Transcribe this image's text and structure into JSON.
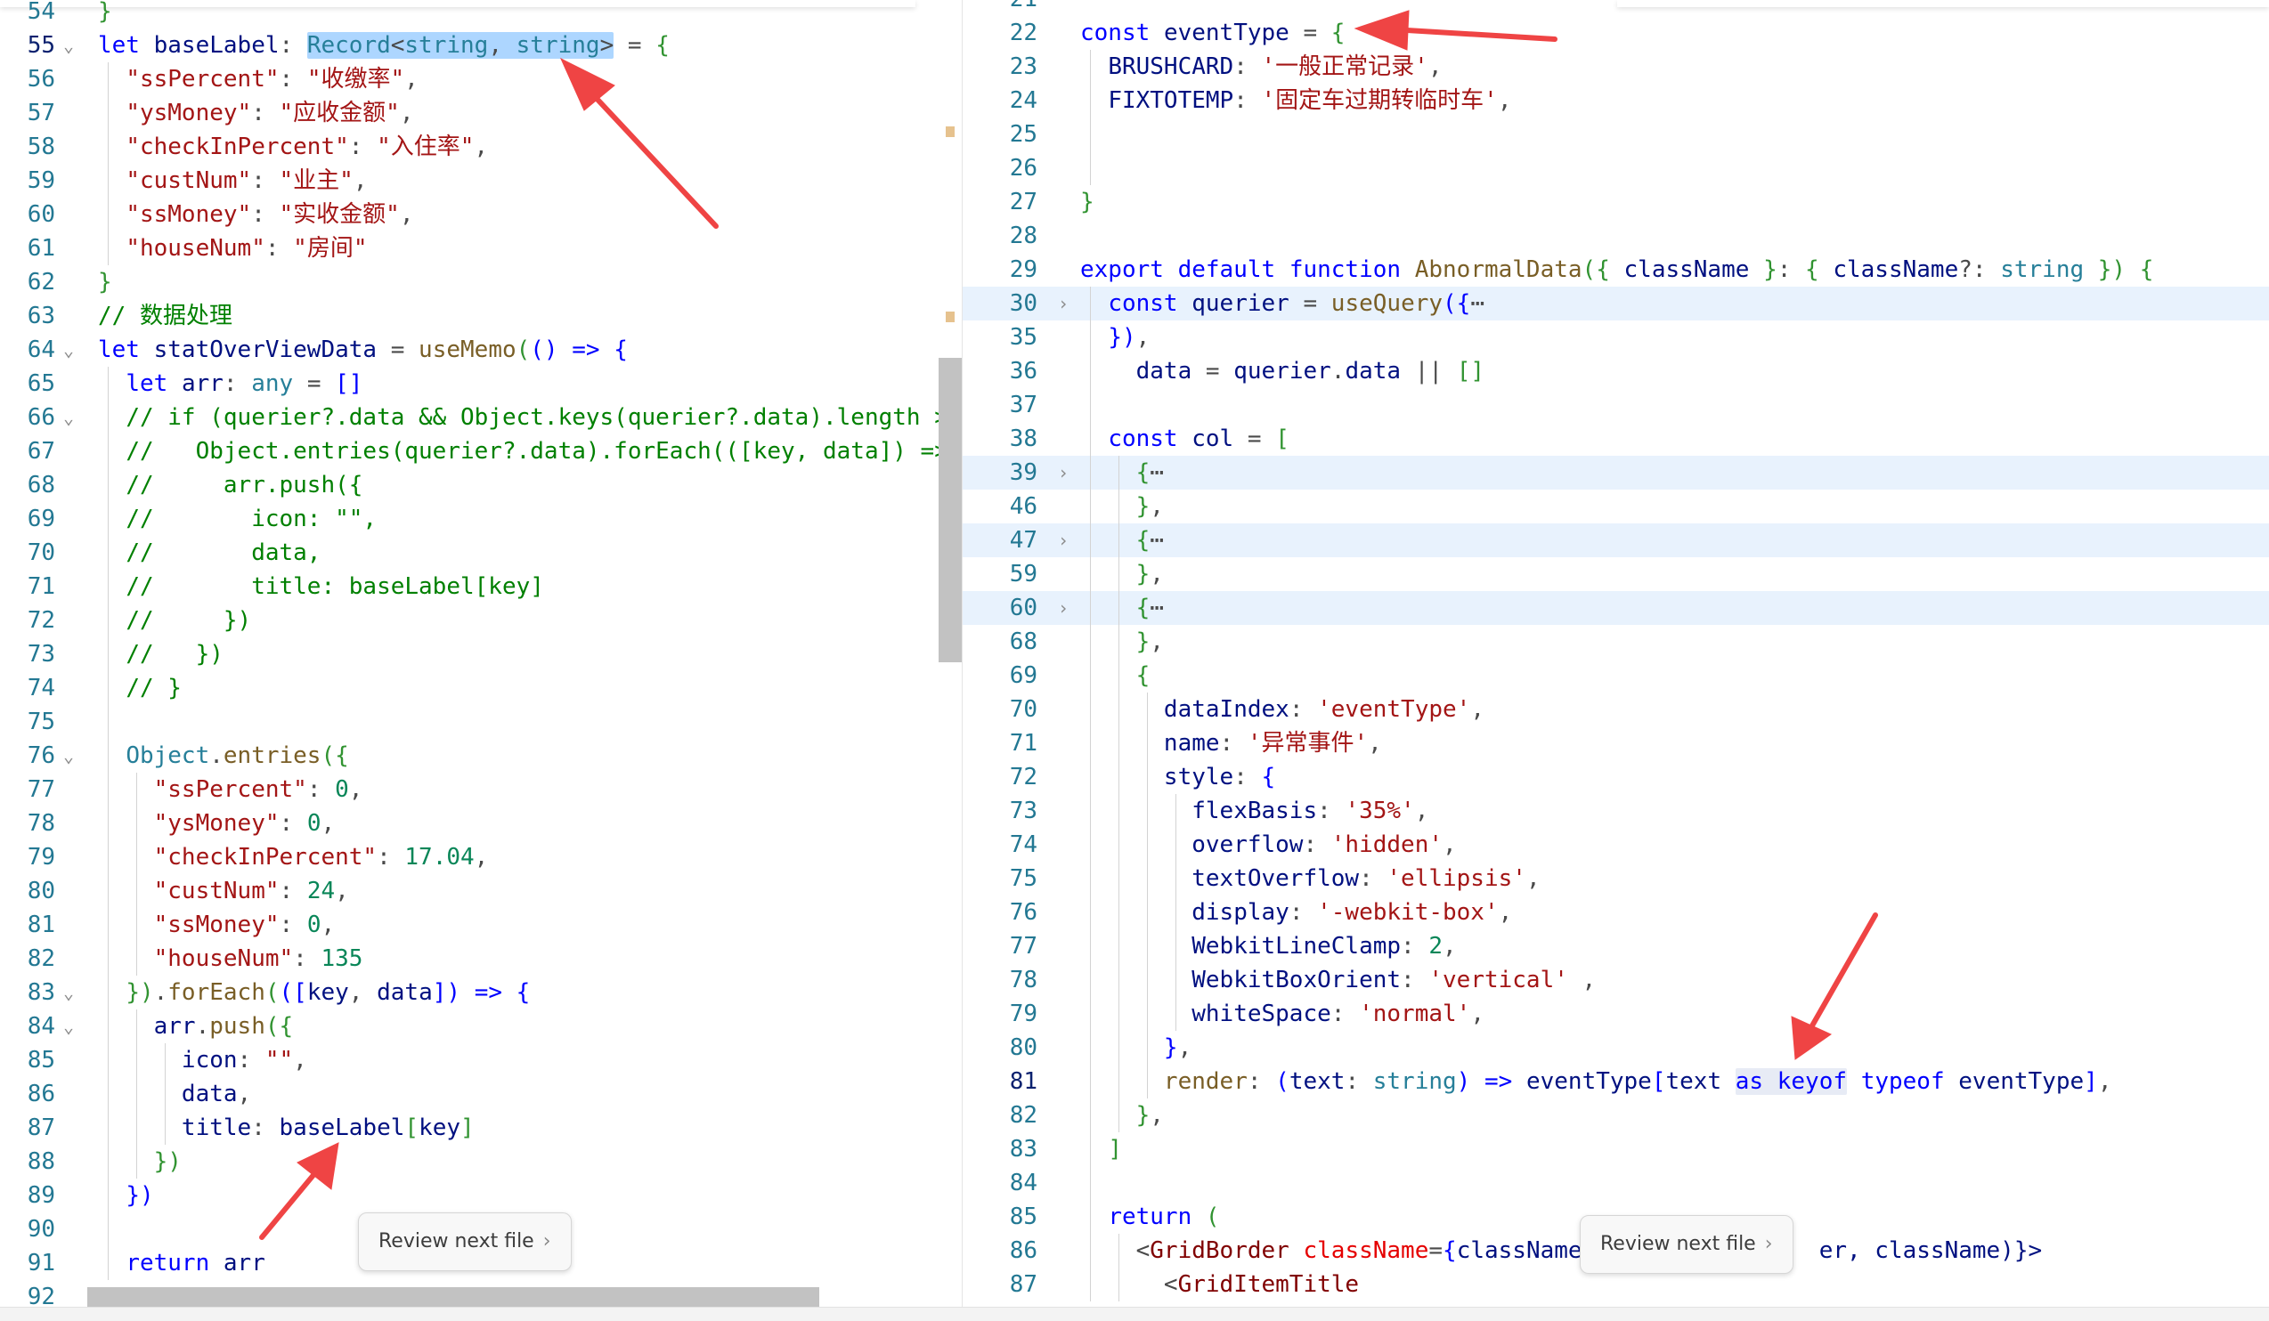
{
  "review_label": "Review next file",
  "review_chevron": "›",
  "fold_glyph": "⌄",
  "collapsed_glyph": "›",
  "ellipsis": "⋯",
  "accent_colors": {
    "annotation_arrow": "#ef4444",
    "selection": "#add6ff",
    "folded_line": "#e8f2fd"
  },
  "left": {
    "ln": [
      "54",
      "55",
      "56",
      "57",
      "58",
      "59",
      "60",
      "61",
      "62",
      "63",
      "64",
      "65",
      "66",
      "67",
      "68",
      "69",
      "70",
      "71",
      "72",
      "73",
      "74",
      "75",
      "76",
      "77",
      "78",
      "79",
      "80",
      "81",
      "82",
      "83",
      "84",
      "85",
      "86",
      "87",
      "88",
      "89",
      "90",
      "91",
      "92"
    ],
    "t": {
      "let": "let",
      "baseLabel": "baseLabel",
      "Record": "Record",
      "string": "string",
      "ssPercent": "\"ssPercent\"",
      "ssPercent_v": "\"收缴率\"",
      "ysMoney": "\"ysMoney\"",
      "ysMoney_v": "\"应收金额\"",
      "checkInPercent": "\"checkInPercent\"",
      "checkInPercent_v": "\"入住率\"",
      "custNum": "\"custNum\"",
      "custNum_v": "\"业主\"",
      "ssMoney": "\"ssMoney\"",
      "ssMoney_v": "\"实收金额\"",
      "houseNum": "\"houseNum\"",
      "houseNum_v": "\"房间\"",
      "comment_data": "// 数据处理",
      "statOverViewData": "statOverViewData",
      "useMemo": "useMemo",
      "arr": "arr",
      "any": "any",
      "c66": "// if (querier?.data && Object.keys(querier?.data).length >",
      "c67": "//   Object.entries(querier?.data).forEach(([key, data]) =>",
      "c68": "//     arr.push({",
      "c69": "//       icon: \"\",",
      "c70": "//       data,",
      "c71": "//       title: baseLabel[key]",
      "c72": "//     })",
      "c73": "//   })",
      "c74": "// }",
      "Object": "Object",
      "entries": "entries",
      "n0": "0",
      "n1704": "17.04",
      "n24": "24",
      "n135": "135",
      "forEach": "forEach",
      "key": "key",
      "data": "data",
      "push": "push",
      "icon": "icon",
      "empty": "\"\"",
      "title": "title",
      "return": "return"
    }
  },
  "right": {
    "ln": [
      "21",
      "22",
      "23",
      "24",
      "25",
      "26",
      "27",
      "28",
      "29",
      "30",
      "35",
      "36",
      "37",
      "38",
      "39",
      "46",
      "47",
      "59",
      "60",
      "68",
      "69",
      "70",
      "71",
      "72",
      "73",
      "74",
      "75",
      "76",
      "77",
      "78",
      "79",
      "80",
      "81",
      "82",
      "83",
      "84",
      "85",
      "86",
      "87"
    ],
    "t": {
      "const": "const",
      "eventType": "eventType",
      "BRUSHCARD": "BRUSHCARD",
      "BRUSHCARD_v": "'一般正常记录'",
      "FIXTOTEMP": "FIXTOTEMP",
      "FIXTOTEMP_v": "'固定车过期转临时车'",
      "export": "export",
      "default": "default",
      "function": "function",
      "AbnormalData": "AbnormalData",
      "className": "className",
      "string": "string",
      "querier": "querier",
      "useQuery": "useQuery",
      "data": "data",
      "col": "col",
      "dataIndex": "dataIndex",
      "dataIndex_v": "'eventType'",
      "name": "name",
      "name_v": "'异常事件'",
      "style": "style",
      "flexBasis": "flexBasis",
      "flexBasis_v": "'35%'",
      "overflow": "overflow",
      "overflow_v": "'hidden'",
      "textOverflow": "textOverflow",
      "textOverflow_v": "'ellipsis'",
      "display": "display",
      "display_v": "'-webkit-box'",
      "WebkitLineClamp": "WebkitLineClamp",
      "n2": "2",
      "WebkitBoxOrient": "WebkitBoxOrient",
      "WebkitBoxOrient_v": "'vertical'",
      "whiteSpace": "whiteSpace",
      "whiteSpace_v": "'normal'",
      "render": "render",
      "text": "text",
      "as": "as",
      "keyof": "keyof",
      "typeof": "typeof",
      "return": "return",
      "GridBorder": "GridBorder",
      "className_tail": "er, className)}>",
      "GridItemTitle": "GridItemTitle"
    }
  }
}
